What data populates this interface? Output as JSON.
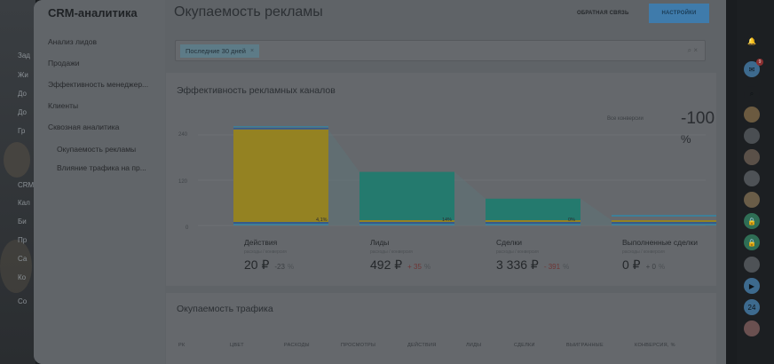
{
  "background_app": {
    "fragments": [
      "Зад",
      "Жи",
      "До",
      "До",
      "Гр",
      "CRM",
      "Кал",
      "Би",
      "Пр",
      "Са",
      "Ко",
      "Со"
    ]
  },
  "app": {
    "title": "CRM-аналитика"
  },
  "sidebar": {
    "items": [
      {
        "label": "Анализ лидов"
      },
      {
        "label": "Продажи"
      },
      {
        "label": "Эффективность менеджер..."
      },
      {
        "label": "Клиенты"
      },
      {
        "label": "Сквозная аналитика"
      }
    ],
    "subitems": [
      {
        "label": "Окупаемость рекламы"
      },
      {
        "label": "Влияние трафика на пр..."
      }
    ]
  },
  "header": {
    "title": "Окупаемость рекламы",
    "feedback_label": "ОБРАТНАЯ СВЯЗЬ",
    "settings_label": "НАСТРОЙКИ"
  },
  "filter": {
    "chip_label": "Последние 30 дней",
    "chip_close": "×",
    "right_icons": "⌕ ×"
  },
  "channels_card": {
    "title": "Эффективность рекламных каналов",
    "conversion_label": "Все конверсии",
    "conversion_value": "-100",
    "conversion_unit": "%"
  },
  "chart_data": {
    "type": "funnel-bar",
    "yticks": [
      "240",
      "120",
      "0"
    ],
    "ylim": [
      0,
      240
    ],
    "colors": {
      "primary": "#948222",
      "teal": "#247a6e",
      "blue": "#365a8a",
      "cyan": "#3e7f98"
    },
    "transition_labels": [
      "4,1%",
      "14%",
      "0%"
    ],
    "stages": [
      {
        "name": "Действия",
        "sub": "расходы / конверсия",
        "value": "20 ₽",
        "delta": "-23",
        "delta_pct": "%",
        "delta_type": "neg",
        "bar_color": "primary",
        "bar_value": 240
      },
      {
        "name": "Лиды",
        "sub": "расходы / конверсия",
        "value": "492 ₽",
        "delta": "+ 35",
        "delta_pct": "%",
        "delta_type": "pos",
        "bar_color": "teal",
        "bar_value": 128
      },
      {
        "name": "Сделки",
        "sub": "расходы / конверсия",
        "value": "3 336 ₽",
        "delta": "- 391",
        "delta_pct": "%",
        "delta_type": "pos",
        "bar_color": "teal",
        "bar_value": 57
      },
      {
        "name": "Выполненные сделки",
        "sub": "расходы / конверсия",
        "value": "0 ₽",
        "delta": "+ 0",
        "delta_pct": "%",
        "delta_type": "neutral",
        "bar_color": "teal",
        "bar_value": 0
      }
    ]
  },
  "traffic_card": {
    "title": "Окупаемость трафика",
    "columns": [
      "РК",
      "ЦВЕТ",
      "РАСХОДЫ",
      "ПРОСМОТРЫ",
      "ДЕЙСТВИЯ",
      "ЛИДЫ",
      "СДЕЛКИ",
      "ВЫИГРАННЫЕ",
      "КОНВЕРСИЯ, %"
    ]
  },
  "rail": {
    "items": [
      {
        "icon": "bell-icon",
        "glyph": "🔔",
        "color": "#1c1f22"
      },
      {
        "icon": "chat-icon",
        "glyph": "✉",
        "color": "#3d6a8e",
        "badge": "9"
      },
      {
        "icon": "search-icon",
        "glyph": "⌕",
        "color": "#1c1f22"
      },
      {
        "icon": "avatar-1-icon",
        "glyph": "",
        "color": "#6b5a40"
      },
      {
        "icon": "avatar-2-icon",
        "glyph": "",
        "color": "#4a4e52"
      },
      {
        "icon": "avatar-3-icon",
        "glyph": "",
        "color": "#5a5048"
      },
      {
        "icon": "avatar-4-icon",
        "glyph": "",
        "color": "#4e5256"
      },
      {
        "icon": "avatar-5-icon",
        "glyph": "",
        "color": "#6a5d48"
      },
      {
        "icon": "lock-icon",
        "glyph": "🔒",
        "color": "#2f6e55"
      },
      {
        "icon": "lock-2-icon",
        "glyph": "🔒",
        "color": "#2f6e55"
      },
      {
        "icon": "avatar-6-icon",
        "glyph": "",
        "color": "#4e5256"
      },
      {
        "icon": "camera-icon",
        "glyph": "▶",
        "color": "#3d6a8e"
      },
      {
        "icon": "b24-icon",
        "glyph": "24",
        "color": "#3d6a8e"
      },
      {
        "icon": "avatar-7-icon",
        "glyph": "",
        "color": "#6a5050"
      }
    ]
  }
}
